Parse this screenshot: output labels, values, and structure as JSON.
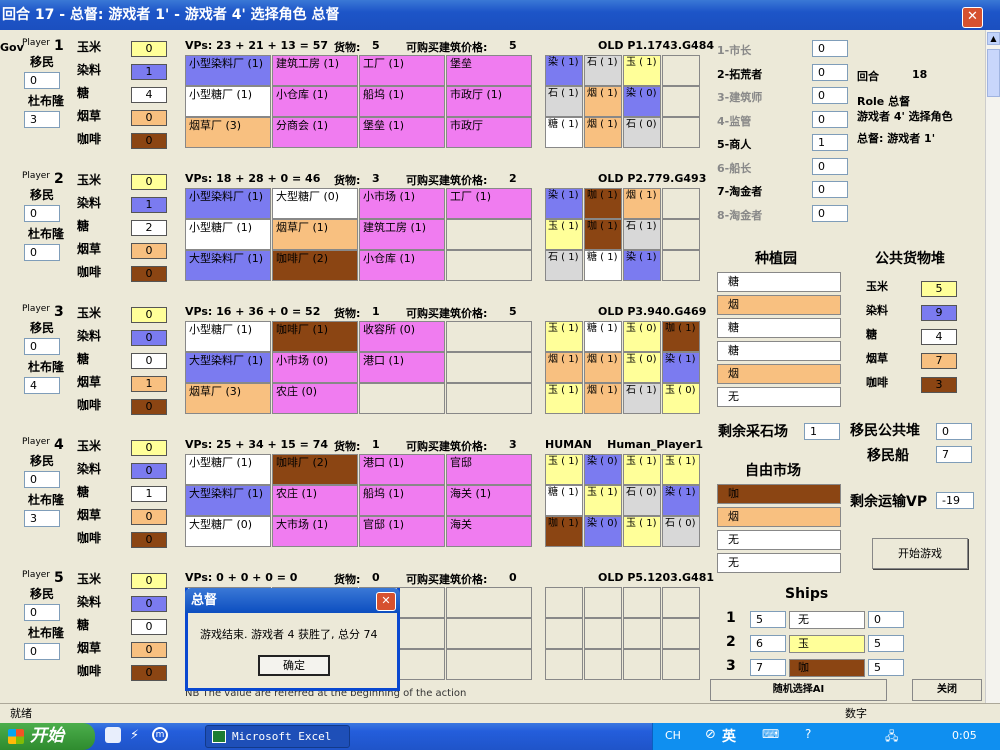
{
  "window": {
    "title": "回合 17 - 总督: 游戏者 1' - 游戏者 4' 选择角色 总督",
    "close": "✕"
  },
  "labels": {
    "corn": "玉米",
    "indigo": "染料",
    "sugar": "糖",
    "tobacco": "烟草",
    "coffee": "咖啡",
    "colonist": "移民",
    "doubloon": "杜布隆",
    "goods": "货物:",
    "price": "可购买建筑价格:"
  },
  "players": [
    {
      "name": "Player",
      "gov": "Gov",
      "num": "1",
      "colonist": "0",
      "doubloon": "3",
      "goods": [
        "0",
        "1",
        "4",
        "0",
        "0"
      ],
      "vps": "VPs: 23 + 21 + 13 = 57",
      "cargo": "5",
      "price": "5",
      "old": "OLD P1.1743.G484",
      "buildings": [
        [
          "小型染料厂 (1)",
          "c-bl"
        ],
        [
          "建筑工房 (1)",
          "c-pk"
        ],
        [
          "工厂 (1)",
          "c-pk"
        ],
        [
          "堡垒",
          "c-pk"
        ],
        [
          "小型糖厂 (1)",
          "c-wh"
        ],
        [
          "小仓库 (1)",
          "c-pk"
        ],
        [
          "船坞 (1)",
          "c-pk"
        ],
        [
          "市政厅 (1)",
          "c-pk"
        ],
        [
          "烟草厂 (3)",
          "c-or"
        ],
        [
          "分商会 (1)",
          "c-pk"
        ],
        [
          "堡垒 (1)",
          "c-pk"
        ],
        [
          "市政厅",
          "c-pk"
        ]
      ],
      "plantations": [
        [
          "染 ( 1)",
          "c-bl"
        ],
        [
          "石 ( 1)",
          "c-gr"
        ],
        [
          "玉 ( 1)",
          "c-ye"
        ],
        [
          "",
          "c-em"
        ],
        [
          "石 ( 1)",
          "c-gr"
        ],
        [
          "烟 ( 1)",
          "c-or"
        ],
        [
          "染 ( 0)",
          "c-bl"
        ],
        [
          "",
          "c-em"
        ],
        [
          "糖 ( 1)",
          "c-wh"
        ],
        [
          "烟 ( 1)",
          "c-or"
        ],
        [
          "石 ( 0)",
          "c-gr"
        ],
        [
          "",
          "c-em"
        ]
      ]
    },
    {
      "name": "Player",
      "gov": "",
      "num": "2",
      "colonist": "0",
      "doubloon": "0",
      "goods": [
        "0",
        "1",
        "2",
        "0",
        "0"
      ],
      "vps": "VPs: 18 + 28 + 0 = 46",
      "cargo": "3",
      "price": "2",
      "old": "OLD P2.779.G493",
      "buildings": [
        [
          "小型染料厂 (1)",
          "c-bl"
        ],
        [
          "大型糖厂 (0)",
          "c-wh"
        ],
        [
          "小市场 (1)",
          "c-pk"
        ],
        [
          "工厂 (1)",
          "c-pk"
        ],
        [
          "小型糖厂 (1)",
          "c-wh"
        ],
        [
          "烟草厂 (1)",
          "c-or"
        ],
        [
          "建筑工房 (1)",
          "c-pk"
        ],
        [
          "",
          "c-em"
        ],
        [
          "大型染料厂 (1)",
          "c-bl"
        ],
        [
          "咖啡厂 (2)",
          "c-br"
        ],
        [
          "小仓库 (1)",
          "c-pk"
        ],
        [
          "",
          "c-em"
        ]
      ],
      "plantations": [
        [
          "染 ( 1)",
          "c-bl"
        ],
        [
          "咖 ( 1)",
          "c-br"
        ],
        [
          "烟 ( 1)",
          "c-or"
        ],
        [
          "",
          "c-em"
        ],
        [
          "玉 ( 1)",
          "c-ye"
        ],
        [
          "咖 ( 1)",
          "c-br"
        ],
        [
          "石 ( 1)",
          "c-gr"
        ],
        [
          "",
          "c-em"
        ],
        [
          "石 ( 1)",
          "c-gr"
        ],
        [
          "糖 ( 1)",
          "c-wh"
        ],
        [
          "染 ( 1)",
          "c-bl"
        ],
        [
          "",
          "c-em"
        ]
      ]
    },
    {
      "name": "Player",
      "gov": "",
      "num": "3",
      "colonist": "0",
      "doubloon": "4",
      "goods": [
        "0",
        "0",
        "0",
        "1",
        "0"
      ],
      "vps": "VPs: 16 + 36 + 0 = 52",
      "cargo": "1",
      "price": "5",
      "old": "OLD P3.940.G469",
      "buildings": [
        [
          "小型糖厂 (1)",
          "c-wh"
        ],
        [
          "咖啡厂 (1)",
          "c-br"
        ],
        [
          "收容所 (0)",
          "c-pk"
        ],
        [
          "",
          "c-em"
        ],
        [
          "大型染料厂 (1)",
          "c-bl"
        ],
        [
          "小市场 (0)",
          "c-pk"
        ],
        [
          "港口 (1)",
          "c-pk"
        ],
        [
          "",
          "c-em"
        ],
        [
          "烟草厂 (3)",
          "c-or"
        ],
        [
          "农庄 (0)",
          "c-pk"
        ],
        [
          "",
          "c-em"
        ],
        [
          "",
          "c-em"
        ]
      ],
      "plantations": [
        [
          "玉 ( 1)",
          "c-ye"
        ],
        [
          "糖 ( 1)",
          "c-wh"
        ],
        [
          "玉 ( 0)",
          "c-ye"
        ],
        [
          "咖 ( 1)",
          "c-br"
        ],
        [
          "烟 ( 1)",
          "c-or"
        ],
        [
          "烟 ( 1)",
          "c-or"
        ],
        [
          "玉 ( 0)",
          "c-ye"
        ],
        [
          "染 ( 1)",
          "c-bl"
        ],
        [
          "玉 ( 1)",
          "c-ye"
        ],
        [
          "烟 ( 1)",
          "c-or"
        ],
        [
          "石 ( 1)",
          "c-gr"
        ],
        [
          "玉 ( 0)",
          "c-ye"
        ]
      ]
    },
    {
      "name": "Player",
      "gov": "",
      "num": "4",
      "colonist": "0",
      "doubloon": "3",
      "goods": [
        "0",
        "0",
        "1",
        "0",
        "0"
      ],
      "vps": "VPs: 25 + 34 + 15 = 74",
      "cargo": "1",
      "price": "3",
      "old": "HUMAN    Human_Player1",
      "buildings": [
        [
          "小型糖厂 (1)",
          "c-wh"
        ],
        [
          "咖啡厂 (2)",
          "c-br"
        ],
        [
          "港口 (1)",
          "c-pk"
        ],
        [
          "官邸",
          "c-pk"
        ],
        [
          "大型染料厂 (1)",
          "c-bl"
        ],
        [
          "农庄 (1)",
          "c-pk"
        ],
        [
          "船坞 (1)",
          "c-pk"
        ],
        [
          "海关 (1)",
          "c-pk"
        ],
        [
          "大型糖厂 (0)",
          "c-wh"
        ],
        [
          "大市场 (1)",
          "c-pk"
        ],
        [
          "官邸 (1)",
          "c-pk"
        ],
        [
          "海关",
          "c-pk"
        ]
      ],
      "plantations": [
        [
          "玉 ( 1)",
          "c-ye"
        ],
        [
          "染 ( 0)",
          "c-bl"
        ],
        [
          "玉 ( 1)",
          "c-ye"
        ],
        [
          "玉 ( 1)",
          "c-ye"
        ],
        [
          "糖 ( 1)",
          "c-wh"
        ],
        [
          "玉 ( 1)",
          "c-ye"
        ],
        [
          "石 ( 0)",
          "c-gr"
        ],
        [
          "染 ( 1)",
          "c-bl"
        ],
        [
          "咖 ( 1)",
          "c-br"
        ],
        [
          "染 ( 0)",
          "c-bl"
        ],
        [
          "玉 ( 1)",
          "c-ye"
        ],
        [
          "石 ( 0)",
          "c-gr"
        ]
      ]
    },
    {
      "name": "Player",
      "gov": "",
      "num": "5",
      "colonist": "0",
      "doubloon": "0",
      "goods": [
        "0",
        "0",
        "0",
        "0",
        "0"
      ],
      "vps": "VPs: 0 + 0 + 0 = 0",
      "cargo": "0",
      "price": "0",
      "old": "OLD P5.1203.G481",
      "buildings": [],
      "plantations": []
    }
  ],
  "roles": [
    {
      "label": "1-市长",
      "value": "0",
      "active": false
    },
    {
      "label": "2-拓荒者",
      "value": "0",
      "active": true
    },
    {
      "label": "3-建筑师",
      "value": "0",
      "active": false
    },
    {
      "label": "4-监管",
      "value": "0",
      "active": false
    },
    {
      "label": "5-商人",
      "value": "1",
      "active": true
    },
    {
      "label": "6-船长",
      "value": "0",
      "active": false
    },
    {
      "label": "7-淘金者",
      "value": "0",
      "active": true
    },
    {
      "label": "8-淘金者",
      "value": "0",
      "active": false
    }
  ],
  "info": {
    "round_label": "回合",
    "round": "18",
    "role": "Role  总督",
    "role2": "游戏者 4' 选择角色",
    "gov": "总督: 游戏者 1'"
  },
  "plantation_pool": {
    "title": "种植园",
    "items": [
      [
        "糖",
        "c-wh"
      ],
      [
        "烟",
        "c-or"
      ],
      [
        "糖",
        "c-wh"
      ],
      [
        "糖",
        "c-wh"
      ],
      [
        "烟",
        "c-or"
      ],
      [
        "无",
        "c-wh"
      ]
    ]
  },
  "goods_supply": {
    "title": "公共货物堆",
    "items": [
      [
        "玉米",
        "5",
        "c-ye"
      ],
      [
        "染料",
        "9",
        "c-bl"
      ],
      [
        "糖",
        "4",
        "c-wh"
      ],
      [
        "烟草",
        "7",
        "c-or"
      ],
      [
        "咖啡",
        "3",
        "c-br"
      ]
    ]
  },
  "quarries": {
    "label": "剩余采石场",
    "value": "1"
  },
  "colonist_supply": {
    "label": "移民公共堆",
    "value": "0"
  },
  "colonist_ship": {
    "label": "移民船",
    "value": "7"
  },
  "market": {
    "title": "自由市场",
    "items": [
      [
        "咖",
        "c-br"
      ],
      [
        "烟",
        "c-or"
      ],
      [
        "无",
        "c-wh"
      ],
      [
        "无",
        "c-wh"
      ]
    ]
  },
  "vp_left": {
    "label": "剩余运输VP",
    "value": "-19"
  },
  "start_button": "开始游戏",
  "ships": {
    "title": "Ships",
    "rows": [
      [
        "1",
        "5",
        "无",
        "0",
        "c-wh"
      ],
      [
        "2",
        "6",
        "玉",
        "5",
        "c-ye"
      ],
      [
        "3",
        "7",
        "咖",
        "5",
        "c-br"
      ]
    ]
  },
  "random_ai": "随机选择AI",
  "close_btn": "关闭",
  "note": "NB The value are referred at the beginning of the action",
  "dialog": {
    "title": "总督",
    "message": "游戏结束. 游戏者 4 获胜了, 总分 74",
    "ok": "确定"
  },
  "status": {
    "left": "就绪",
    "num": "数字"
  },
  "taskbar": {
    "start": "开始",
    "app": "Microsoft Excel ...",
    "lang": "CH",
    "ime": "英",
    "time": "0:05"
  }
}
